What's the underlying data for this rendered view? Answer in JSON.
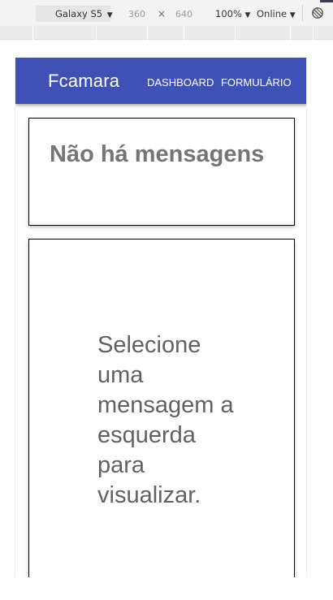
{
  "devtools": {
    "device": "Galaxy S5",
    "width": "360",
    "times": "×",
    "height": "640",
    "zoom": "100%",
    "network": "Online",
    "caret": "▼",
    "rotate_icon": "rotate-icon"
  },
  "app": {
    "brand": "Fcamara",
    "nav": [
      {
        "label": "DASHBOARD"
      },
      {
        "label": "FORMULÁRIO"
      }
    ],
    "header_color": "#3f51b5"
  },
  "messages": {
    "empty_title": "Não há mensagens"
  },
  "detail": {
    "placeholder": "Selecione uma mensagem a esquerda para visualizar."
  }
}
